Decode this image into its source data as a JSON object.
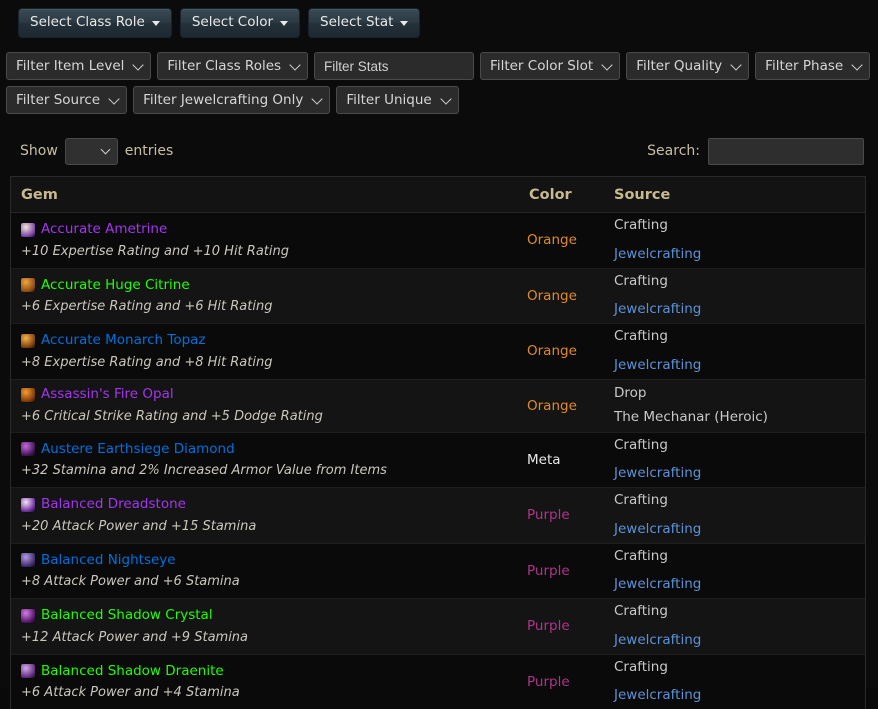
{
  "top_buttons": [
    {
      "label": "Select Class Role",
      "icon": "caret-down-icon"
    },
    {
      "label": "Select Color",
      "icon": "caret-down-icon"
    },
    {
      "label": "Select Stat",
      "icon": "caret-down-icon"
    }
  ],
  "filters_row1": [
    {
      "type": "select",
      "label": "Filter Item Level"
    },
    {
      "type": "select",
      "label": "Filter Class Roles"
    },
    {
      "type": "text",
      "placeholder": "Filter Stats",
      "value": ""
    },
    {
      "type": "select",
      "label": "Filter Color Slot"
    },
    {
      "type": "select",
      "label": "Filter Quality"
    },
    {
      "type": "select",
      "label": "Filter Phase"
    }
  ],
  "filters_row2": [
    {
      "type": "select",
      "label": "Filter Source"
    },
    {
      "type": "select",
      "label": "Filter Jewelcrafting Only"
    },
    {
      "type": "select",
      "label": "Filter Unique"
    }
  ],
  "datatable_controls": {
    "show_label": "Show",
    "entries_label": "entries",
    "length_value": "",
    "search_label": "Search:",
    "search_value": "",
    "search_placeholder": ""
  },
  "table": {
    "headers": {
      "gem": "Gem",
      "color": "Color",
      "source": "Source"
    },
    "rows": [
      {
        "name": "Accurate Ametrine",
        "name_color": "#a335ee",
        "icon_colors": [
          "#f3e7d2",
          "#7a3fa8"
        ],
        "stats": "+10 Expertise Rating and +10 Hit Rating",
        "color": "Orange",
        "color_hex": "#e08a26",
        "source_type": "Crafting",
        "source_detail": "Jewelcrafting",
        "source_detail_is_link": true
      },
      {
        "name": "Accurate Huge Citrine",
        "name_color": "#1eff00",
        "icon_colors": [
          "#f0a53c",
          "#8a4b14"
        ],
        "stats": "+6 Expertise Rating and +6 Hit Rating",
        "color": "Orange",
        "color_hex": "#e08a26",
        "source_type": "Crafting",
        "source_detail": "Jewelcrafting",
        "source_detail_is_link": true
      },
      {
        "name": "Accurate Monarch Topaz",
        "name_color": "#0070dd",
        "icon_colors": [
          "#f7b24a",
          "#7a3d0c"
        ],
        "stats": "+8 Expertise Rating and +8 Hit Rating",
        "color": "Orange",
        "color_hex": "#e08a26",
        "source_type": "Crafting",
        "source_detail": "Jewelcrafting",
        "source_detail_is_link": true
      },
      {
        "name": "Assassin's Fire Opal",
        "name_color": "#a335ee",
        "icon_colors": [
          "#f79b2e",
          "#7d3a08"
        ],
        "stats": "+6 Critical Strike Rating and +5 Dodge Rating",
        "color": "Orange",
        "color_hex": "#e08a26",
        "source_type": "Drop",
        "source_detail": "The Mechanar (Heroic)",
        "source_detail_is_link": false
      },
      {
        "name": "Austere Earthsiege Diamond",
        "name_color": "#0070dd",
        "icon_colors": [
          "#c86adf",
          "#3c1450"
        ],
        "stats": "+32 Stamina and 2% Increased Armor Value from Items",
        "color": "Meta",
        "color_hex": "#e8e8e8",
        "source_type": "Crafting",
        "source_detail": "Jewelcrafting",
        "source_detail_is_link": true
      },
      {
        "name": "Balanced Dreadstone",
        "name_color": "#a335ee",
        "icon_colors": [
          "#f2e3f7",
          "#6b2a9c"
        ],
        "stats": "+20 Attack Power and +15 Stamina",
        "color": "Purple",
        "color_hex": "#b0348c",
        "source_type": "Crafting",
        "source_detail": "Jewelcrafting",
        "source_detail_is_link": true
      },
      {
        "name": "Balanced Nightseye",
        "name_color": "#0070dd",
        "icon_colors": [
          "#b49ae8",
          "#3a2a66"
        ],
        "stats": "+8 Attack Power and +6 Stamina",
        "color": "Purple",
        "color_hex": "#b0348c",
        "source_type": "Crafting",
        "source_detail": "Jewelcrafting",
        "source_detail_is_link": true
      },
      {
        "name": "Balanced Shadow Crystal",
        "name_color": "#1eff00",
        "icon_colors": [
          "#d77ae8",
          "#4c1560"
        ],
        "stats": "+12 Attack Power and +9 Stamina",
        "color": "Purple",
        "color_hex": "#b0348c",
        "source_type": "Crafting",
        "source_detail": "Jewelcrafting",
        "source_detail_is_link": true
      },
      {
        "name": "Balanced Shadow Draenite",
        "name_color": "#1eff00",
        "icon_colors": [
          "#d9a8ea",
          "#5b2a7a"
        ],
        "stats": "+6 Attack Power and +4 Stamina",
        "color": "Purple",
        "color_hex": "#b0348c",
        "source_type": "Crafting",
        "source_detail": "Jewelcrafting",
        "source_detail_is_link": true
      }
    ]
  }
}
